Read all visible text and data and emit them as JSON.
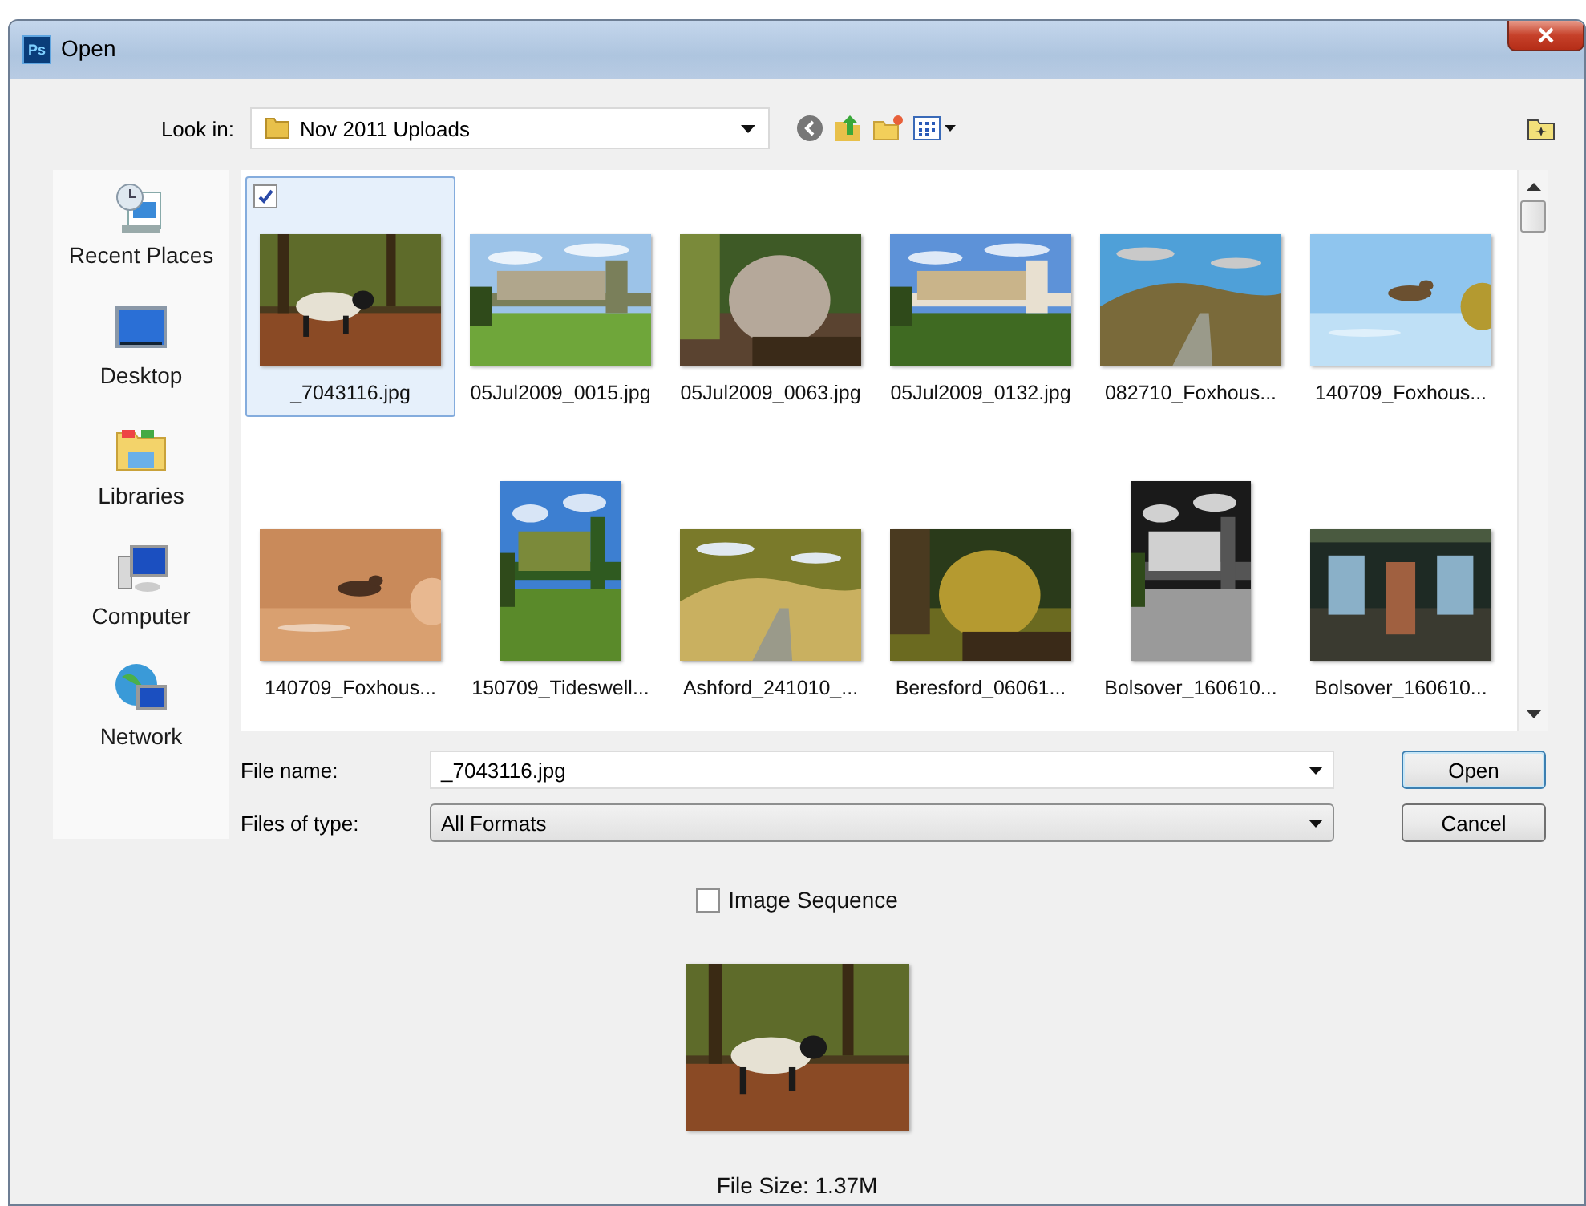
{
  "window": {
    "app_icon": "Ps",
    "title": "Open"
  },
  "look_in": {
    "label": "Look in:",
    "value": "Nov 2011 Uploads"
  },
  "places": [
    {
      "kind": "recent",
      "label": "Recent Places"
    },
    {
      "kind": "desktop",
      "label": "Desktop"
    },
    {
      "kind": "libraries",
      "label": "Libraries"
    },
    {
      "kind": "computer",
      "label": "Computer"
    },
    {
      "kind": "network",
      "label": "Network"
    }
  ],
  "files": [
    {
      "name": "_7043116.jpg",
      "selected": true,
      "checked": true,
      "kind": "picture"
    },
    {
      "name": "05Jul2009_0015.jpg",
      "selected": false,
      "checked": false,
      "kind": "picture"
    },
    {
      "name": "05Jul2009_0063.jpg",
      "selected": false,
      "checked": false,
      "kind": "picture"
    },
    {
      "name": "05Jul2009_0132.jpg",
      "selected": false,
      "checked": false,
      "kind": "picture"
    },
    {
      "name": "082710_Foxhous...",
      "selected": false,
      "checked": false,
      "kind": "picture"
    },
    {
      "name": "140709_Foxhous...",
      "selected": false,
      "checked": false,
      "kind": "picture"
    },
    {
      "name": "140709_Foxhous...",
      "selected": false,
      "checked": false,
      "kind": "picture"
    },
    {
      "name": "150709_Tideswell...",
      "selected": false,
      "checked": false,
      "kind": "picture"
    },
    {
      "name": "Ashford_241010_...",
      "selected": false,
      "checked": false,
      "kind": "picture"
    },
    {
      "name": "Beresford_06061...",
      "selected": false,
      "checked": false,
      "kind": "picture"
    },
    {
      "name": "Bolsover_160610...",
      "selected": false,
      "checked": false,
      "kind": "picture"
    },
    {
      "name": "Bolsover_160610...",
      "selected": false,
      "checked": false,
      "kind": "picture"
    }
  ],
  "file_name": {
    "label": "File name:",
    "value": "_7043116.jpg"
  },
  "file_type": {
    "label": "Files of type:",
    "value": "All Formats"
  },
  "buttons": [
    {
      "label": "Open",
      "default": true
    },
    {
      "label": "Cancel",
      "default": false
    }
  ],
  "image_sequence": {
    "label": "Image Sequence",
    "checked": false
  },
  "preview": {
    "kind": "picture",
    "caption": "File Size: 1.37M"
  }
}
